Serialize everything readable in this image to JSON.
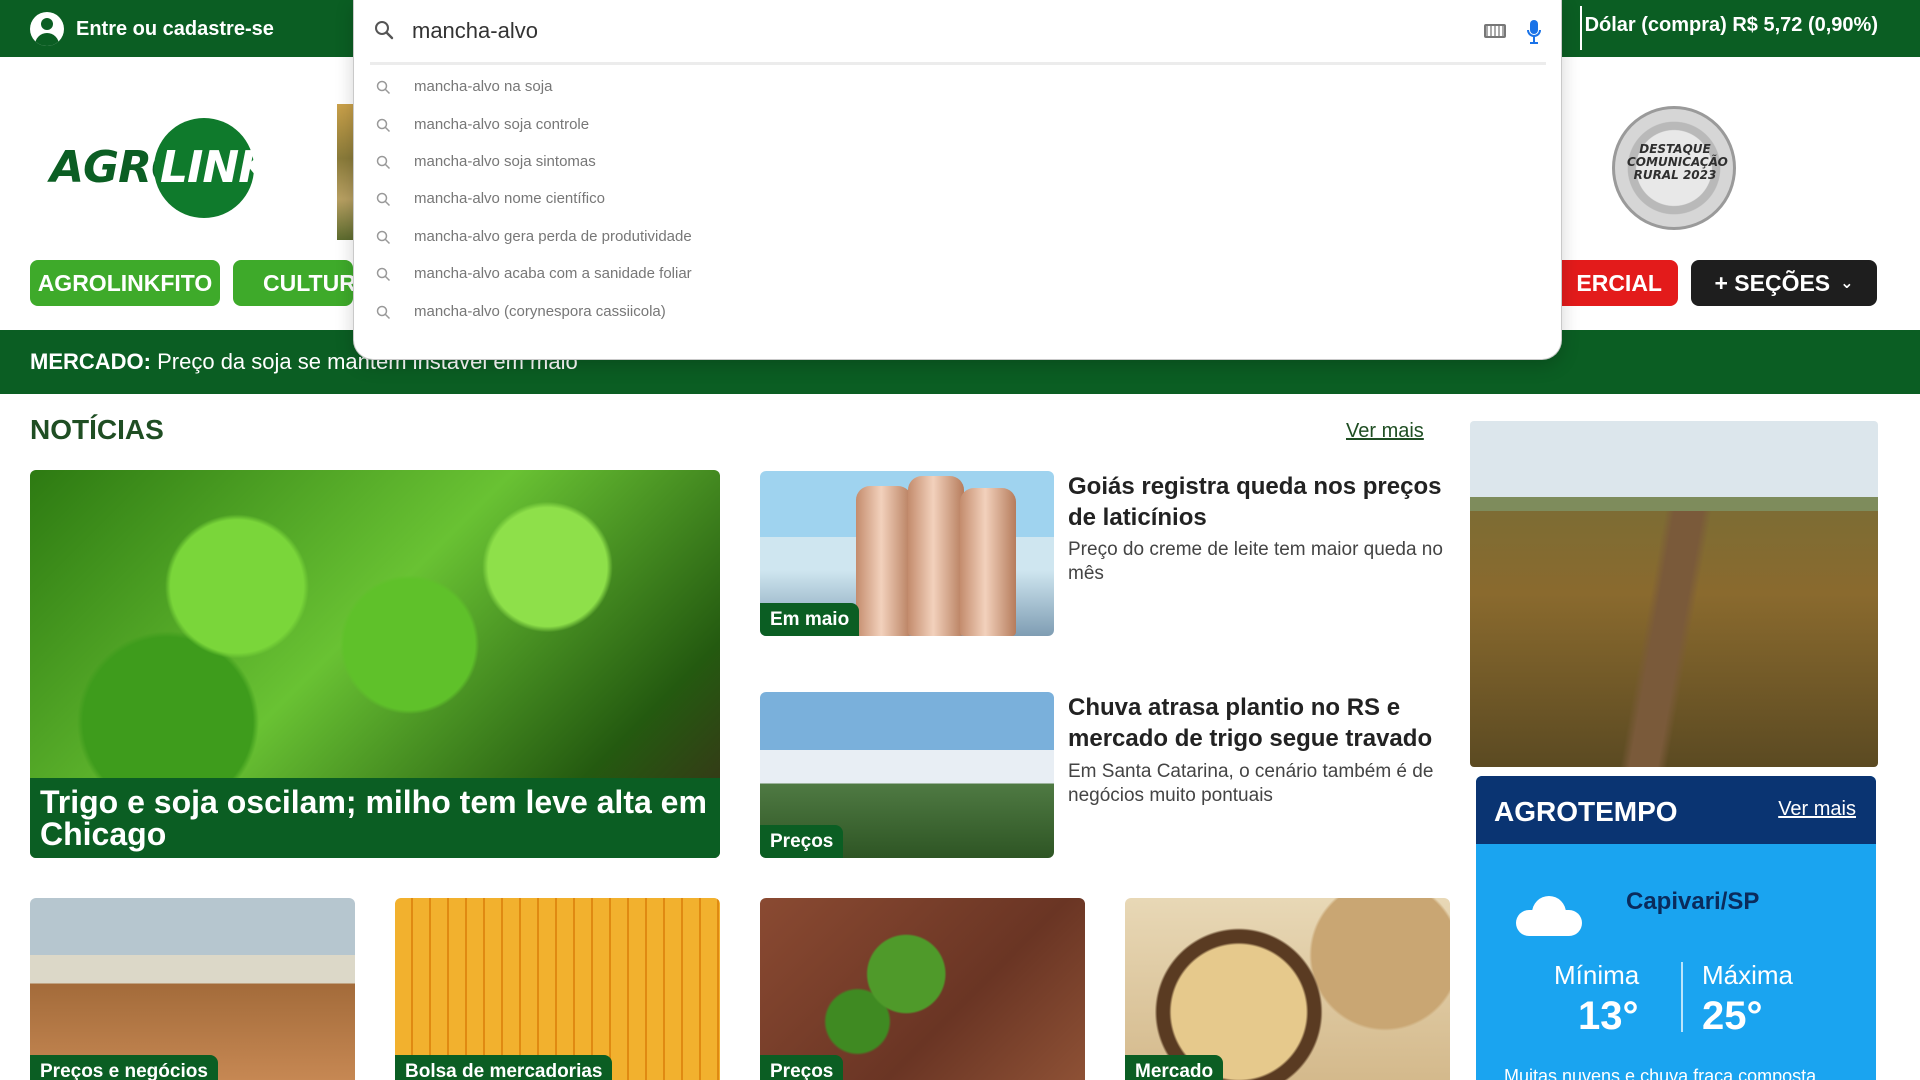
{
  "topbar": {
    "login_label": "Entre ou cadastre-se",
    "dollar": "Dólar (compra) R$ 5,72 (0,90%)"
  },
  "header": {
    "logo_left": "AGRO",
    "logo_right": "LINK",
    "seal_text": "DESTAQUE COMUNICAÇÃO RURAL 2023"
  },
  "nav": {
    "items": [
      "AGROLINKFITO",
      "CULTUR",
      "ERCIAL",
      "+ SEÇÕES"
    ],
    "chevron": "⌄"
  },
  "ticker": {
    "label": "MERCADO:",
    "text": " Preço da soja se mantém instável em maio"
  },
  "news": {
    "section_title": "NOTÍCIAS",
    "see_more": "Ver mais",
    "main": {
      "headline": "Trigo e soja oscilam; milho tem leve alta em Chicago"
    },
    "side": [
      {
        "tag": "Em maio",
        "title": "Goiás registra queda nos preços de laticínios",
        "subtitle": "Preço do creme de leite tem maior queda no mês"
      },
      {
        "tag": "Preços",
        "title": "Chuva atrasa plantio no RS e mercado de trigo segue travado",
        "subtitle": "Em Santa Catarina, o cenário também é de negócios muito pontuais"
      }
    ],
    "bottom": [
      {
        "tag": "Preços e negócios"
      },
      {
        "tag": "Bolsa de mercadorias"
      },
      {
        "tag": "Preços"
      },
      {
        "tag": "Mercado"
      }
    ]
  },
  "agrotempo": {
    "title": "AGROTEMPO",
    "see_more": "Ver mais",
    "city": "Capivari/SP",
    "min_label": "Mínima",
    "min_value": "13°",
    "max_label": "Máxima",
    "max_value": "25°",
    "description": "Muitas nuvens e chuva fraca composta"
  },
  "search": {
    "value": "mancha-alvo",
    "suggestions": [
      "mancha-alvo na soja",
      "mancha-alvo soja controle",
      "mancha-alvo soja sintomas",
      "mancha-alvo nome científico",
      "mancha-alvo gera perda de produtividade",
      "mancha-alvo acaba com a sanidade foliar",
      "mancha-alvo (corynespora cassiicola)"
    ]
  },
  "colors": {
    "brand_green": "#0b5e23",
    "pill_green": "#3eaa2a",
    "commercial_red": "#e31b1b",
    "weather_blue": "#1aa4f0",
    "weather_navy": "#0a3472"
  },
  "icons": [
    "user-icon",
    "search-icon",
    "keyboard-icon",
    "microphone-icon",
    "chevron-down-icon",
    "cloud-icon"
  ]
}
